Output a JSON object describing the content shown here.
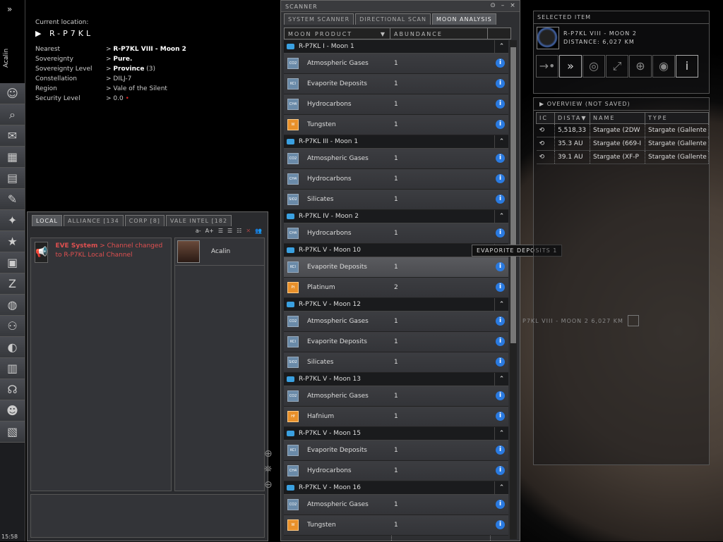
{
  "sidebar": {
    "pilot": "Acalin",
    "clock": "15:58",
    "icons": [
      "character-sheet-icon",
      "people-places-icon",
      "mail-icon",
      "assets-icon",
      "market-icon",
      "contracts-icon",
      "map-icon",
      "corporation-icon",
      "wallet-icon",
      "science-industry-icon",
      "help-icon",
      "fleet-icon",
      "browser-icon",
      "journal-icon",
      "audio-icon",
      "character-icon",
      "calculator-icon"
    ]
  },
  "location": {
    "label": "Current location:",
    "system": "R-P7KL",
    "rows": [
      {
        "k": "Nearest",
        "v": "R-P7KL VIII - Moon 2",
        "bold": true
      },
      {
        "k": "Sovereignty",
        "v": "Pure.",
        "bold": true
      },
      {
        "k": "Sovereignty Level",
        "v": "Province",
        "extra": " (3)",
        "bold": true
      },
      {
        "k": "Constellation",
        "v": "DILJ-7"
      },
      {
        "k": "Region",
        "v": "Vale of the Silent"
      },
      {
        "k": "Security Level",
        "v": "0.0"
      }
    ]
  },
  "scanner": {
    "title": "SCANNER",
    "tabs": [
      "SYSTEM SCANNER",
      "DIRECTIONAL SCAN",
      "MOON ANALYSIS"
    ],
    "active_tab": 2,
    "columns": [
      "MOON PRODUCT",
      "ABUNDANCE"
    ],
    "groups": [
      {
        "name": "R-P7KL I - Moon 1",
        "items": [
          {
            "n": "Atmospheric Gases",
            "a": "1",
            "c": "CO2"
          },
          {
            "n": "Evaporite Deposits",
            "a": "1",
            "c": "KCl"
          },
          {
            "n": "Hydrocarbons",
            "a": "1",
            "c": "CH4"
          },
          {
            "n": "Tungsten",
            "a": "1",
            "c": "W",
            "o": true
          }
        ]
      },
      {
        "name": "R-P7KL III - Moon 1",
        "items": [
          {
            "n": "Atmospheric Gases",
            "a": "1",
            "c": "CO2"
          },
          {
            "n": "Hydrocarbons",
            "a": "1",
            "c": "CH4"
          },
          {
            "n": "Silicates",
            "a": "1",
            "c": "SiO2"
          }
        ]
      },
      {
        "name": "R-P7KL IV - Moon 2",
        "items": [
          {
            "n": "Hydrocarbons",
            "a": "1",
            "c": "CH4"
          }
        ]
      },
      {
        "name": "R-P7KL V - Moon 10",
        "items": [
          {
            "n": "Evaporite Deposits",
            "a": "1",
            "c": "KCl",
            "hl": true
          },
          {
            "n": "Platinum",
            "a": "2",
            "c": "Pt",
            "o": true
          }
        ]
      },
      {
        "name": "R-P7KL V - Moon 12",
        "items": [
          {
            "n": "Atmospheric Gases",
            "a": "1",
            "c": "CO2"
          },
          {
            "n": "Evaporite Deposits",
            "a": "1",
            "c": "KCl"
          },
          {
            "n": "Silicates",
            "a": "1",
            "c": "SiO2"
          }
        ]
      },
      {
        "name": "R-P7KL V - Moon 13",
        "items": [
          {
            "n": "Atmospheric Gases",
            "a": "1",
            "c": "CO2"
          },
          {
            "n": "Hafnium",
            "a": "1",
            "c": "Hf",
            "o": true
          }
        ]
      },
      {
        "name": "R-P7KL V - Moon 15",
        "items": [
          {
            "n": "Evaporite Deposits",
            "a": "1",
            "c": "KCl"
          },
          {
            "n": "Hydrocarbons",
            "a": "1",
            "c": "CH4"
          }
        ]
      },
      {
        "name": "R-P7KL V - Moon 16",
        "items": [
          {
            "n": "Atmospheric Gases",
            "a": "1",
            "c": "CO2"
          },
          {
            "n": "Tungsten",
            "a": "1",
            "c": "W",
            "o": true
          }
        ]
      }
    ]
  },
  "tooltip": "EVAPORITE DEPOSITS 1",
  "chat": {
    "tabs": [
      "LOCAL",
      "ALLIANCE [134",
      "CORP [8]",
      "VALE INTEL [182"
    ],
    "font_smaller": "a-",
    "font_larger": "A+",
    "message": {
      "sender": "EVE System",
      "text": " > Channel changed to R-P7KL Local Channel"
    },
    "members": [
      "Acalin"
    ]
  },
  "selected": {
    "title": "SELECTED ITEM",
    "name": "R-P7KL VIII - MOON 2",
    "distance": "DISTANCE: 6,027 KM",
    "actions": [
      {
        "n": "approach-icon",
        "g": "→•"
      },
      {
        "n": "warp-to-icon",
        "g": "»"
      },
      {
        "n": "orbit-icon",
        "g": "◎"
      },
      {
        "n": "keep-at-range-icon",
        "g": "⤢"
      },
      {
        "n": "lock-target-icon",
        "g": "⊕"
      },
      {
        "n": "look-at-icon",
        "g": "◉"
      },
      {
        "n": "show-info-icon",
        "g": "i"
      }
    ]
  },
  "overview": {
    "title": "OVERVIEW (NOT SAVED)",
    "columns": [
      "IC",
      "DISTA▼",
      "NAME",
      "TYPE"
    ],
    "rows": [
      [
        "5,518,33",
        "Stargate (2DW",
        "Stargate (Gallente"
      ],
      [
        "35.3 AU",
        "Stargate (669-I",
        "Stargate (Gallente"
      ],
      [
        "39.1 AU",
        "Stargate (XF-P",
        "Stargate (Gallente"
      ]
    ]
  },
  "bracket": "P7KL VIII - MOON 2 6,027 KM"
}
